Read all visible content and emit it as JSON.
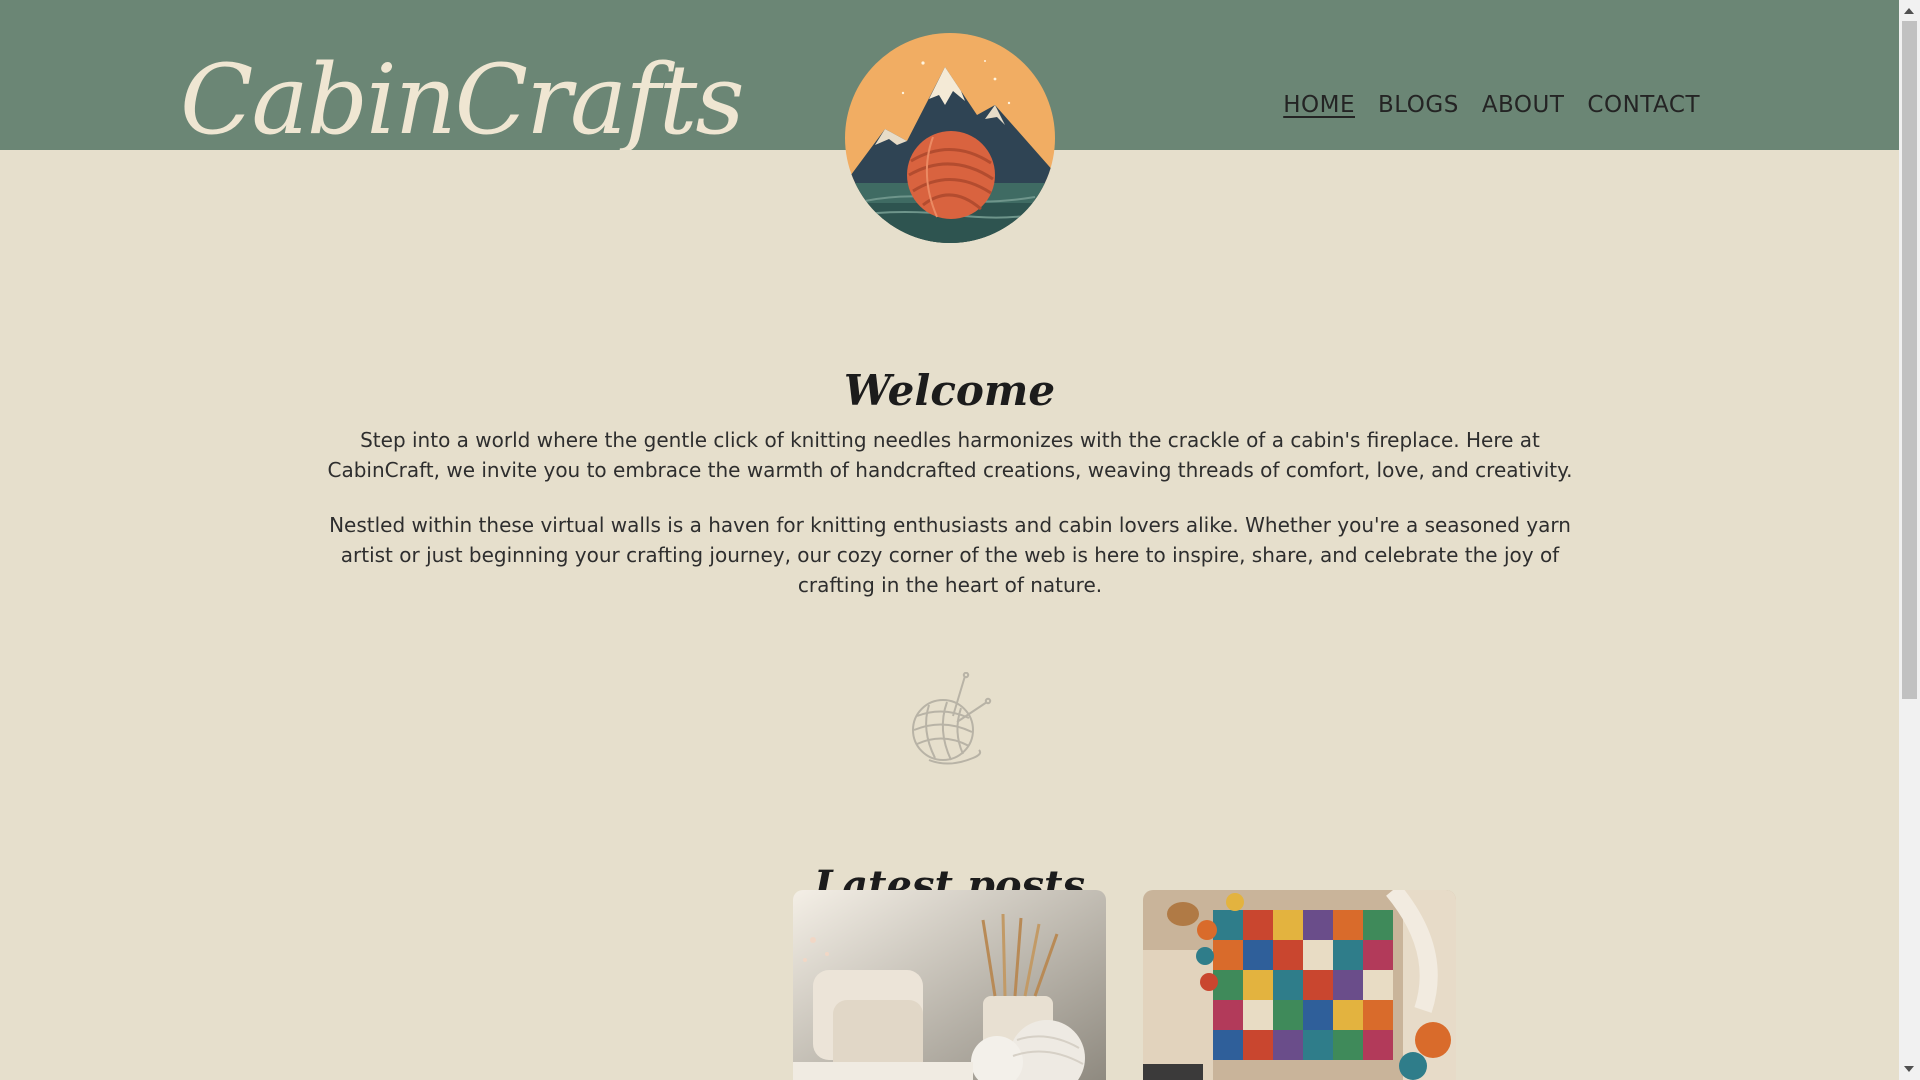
{
  "header": {
    "site_title": "CabinCrafts",
    "nav": [
      {
        "label": "HOME",
        "active": true
      },
      {
        "label": "BLOGS",
        "active": false
      },
      {
        "label": "ABOUT",
        "active": false
      },
      {
        "label": "CONTACT",
        "active": false
      }
    ],
    "logo_icon": "mountain-yarn-logo-icon"
  },
  "main": {
    "welcome_title": "Welcome",
    "paragraphs": [
      "Step into a world where the gentle click of knitting needles harmonizes with the crackle of a cabin's fireplace. Here at CabinCraft, we invite you to embrace the warmth of handcrafted creations, weaving threads of comfort, love, and creativity.",
      "Nestled within these virtual walls is a haven for knitting enthusiasts and cabin lovers alike. Whether you're a seasoned yarn artist or just beginning your crafting journey, our cozy corner of the web is here to inspire, share, and celebrate the joy of crafting in the heart of nature."
    ],
    "divider_icon": "yarn-ball-icon",
    "latest_title": "Latest posts",
    "posts": [
      {
        "image": "knitting-needles-yarn-image"
      },
      {
        "image": "patchwork-blanket-image"
      }
    ]
  },
  "colors": {
    "header_bg": "#6b8675",
    "page_bg": "#e6dfcc",
    "title_color": "#efe6d2"
  }
}
